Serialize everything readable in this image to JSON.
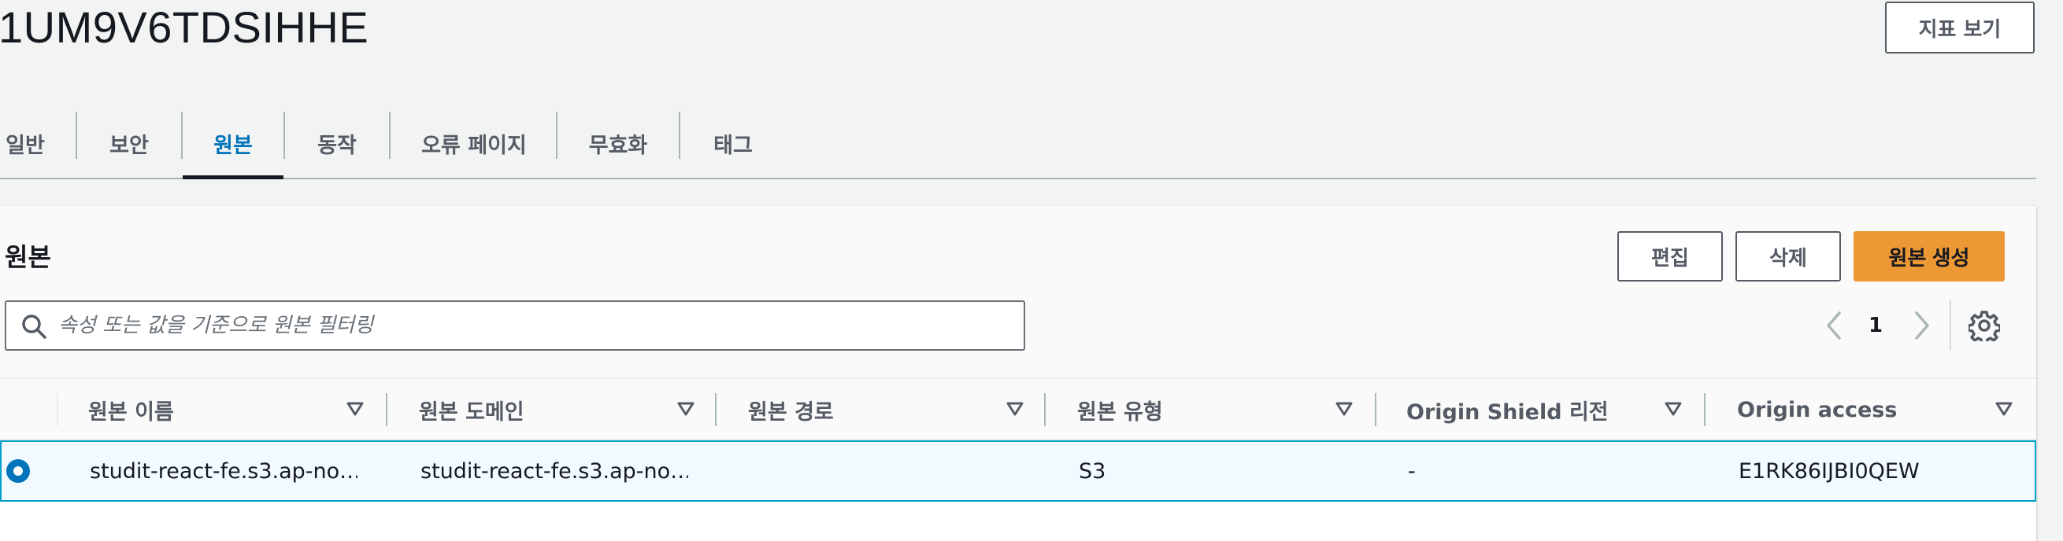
{
  "header": {
    "title": "1UM9V6TDSIHHE",
    "metrics_button": "지표 보기"
  },
  "tabs": [
    {
      "label": "일반"
    },
    {
      "label": "보안"
    },
    {
      "label": "원본",
      "active": true
    },
    {
      "label": "동작"
    },
    {
      "label": "오류 페이지"
    },
    {
      "label": "무효화"
    },
    {
      "label": "태그"
    }
  ],
  "panel": {
    "title": "원본",
    "edit_button": "편집",
    "delete_button": "삭제",
    "create_button": "원본 생성",
    "search_placeholder": "속성 또는 값을 기준으로 원본 필터링",
    "search_icon": "search-icon",
    "pagination": {
      "current_page": "1"
    },
    "settings_icon": "gear-icon"
  },
  "table": {
    "columns": [
      "원본 이름",
      "원본 도메인",
      "원본 경로",
      "원본 유형",
      "Origin Shield 리전",
      "Origin access"
    ],
    "rows": [
      {
        "selected": true,
        "name": "studit-react-fe.s3.ap-no…",
        "domain": "studit-react-fe.s3.ap-no…",
        "path": "",
        "type": "S3",
        "shield_region": "-",
        "access": "E1RK86IJBI0QEW"
      }
    ]
  },
  "colors": {
    "accent": "#0073bb",
    "primary_button": "#ec9835",
    "selected_row_bg": "#f1faff",
    "selected_row_border": "#00a1c9"
  }
}
